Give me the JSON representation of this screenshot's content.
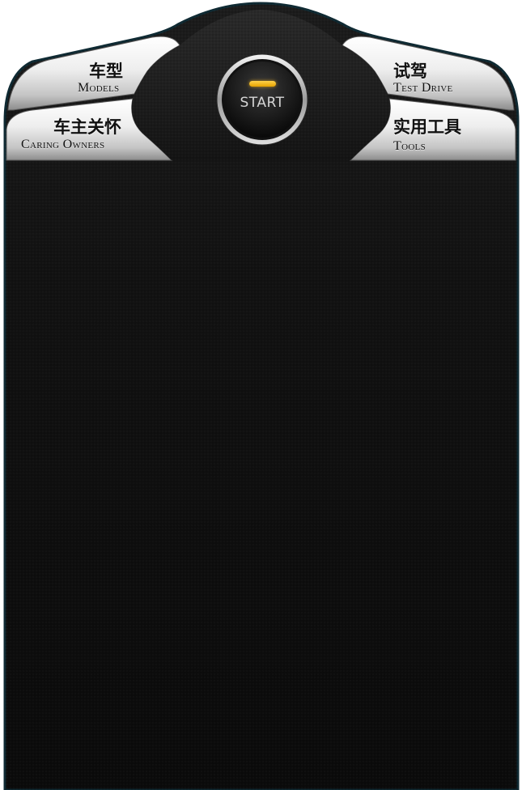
{
  "colors": {
    "panel_background": "#0d0d0d",
    "frame_edge": "#0f2a33",
    "chrome_light": "#f2f2f2",
    "chrome_dark": "#9a9a9a",
    "start_indicator": "#f0b400",
    "start_text": "#d6d6d6"
  },
  "start": {
    "label": "START",
    "indicator_icon": "led-indicator-icon"
  },
  "menu": {
    "models": {
      "cn": "车型",
      "en": "Models"
    },
    "caring_owners": {
      "cn": "车主关怀",
      "en": "Caring Owners"
    },
    "test_drive": {
      "cn": "试驾",
      "en": "Test Drive"
    },
    "tools": {
      "cn": "实用工具",
      "en": "Tools"
    }
  }
}
